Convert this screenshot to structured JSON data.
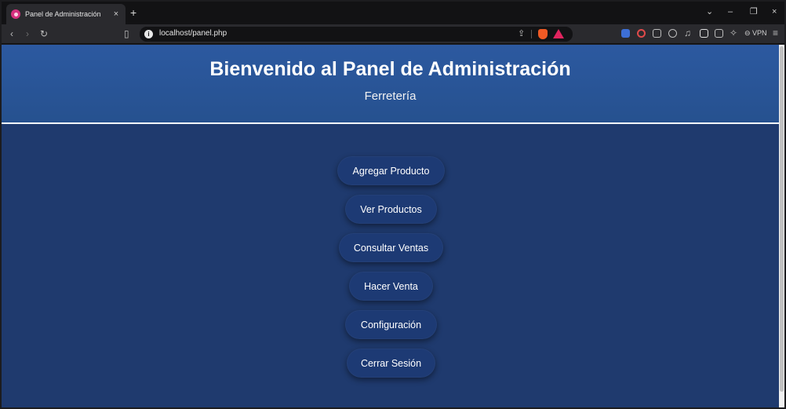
{
  "browser": {
    "tab_title": "Panel de Administración",
    "tab_close": "×",
    "new_tab": "+",
    "url": "localhost/panel.php",
    "vpn_label": "VPN",
    "window_controls": {
      "dropdown": "⌄",
      "minimize": "–",
      "restore": "❐",
      "close": "×"
    }
  },
  "header": {
    "title": "Bienvenido al Panel de Administración",
    "subtitle": "Ferretería"
  },
  "menu": {
    "items": [
      {
        "label": "Agregar Producto"
      },
      {
        "label": "Ver Productos"
      },
      {
        "label": "Consultar Ventas"
      },
      {
        "label": "Hacer Venta"
      },
      {
        "label": "Configuración"
      },
      {
        "label": "Cerrar Sesión"
      }
    ]
  },
  "colors": {
    "header_bg": "#2c59a0",
    "page_bg": "#1f3a6e",
    "button_bg": "#1d3a74",
    "text": "#ffffff"
  }
}
